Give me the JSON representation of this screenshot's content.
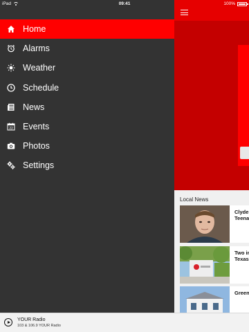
{
  "status_bar": {
    "device": "iPad",
    "time": "09:41",
    "battery": "100%",
    "battery_level": 1.0
  },
  "sidebar": {
    "items": [
      {
        "label": "Home",
        "icon": "home-icon",
        "active": true
      },
      {
        "label": "Alarms",
        "icon": "alarm-clock-icon",
        "active": false
      },
      {
        "label": "Weather",
        "icon": "sun-icon",
        "active": false
      },
      {
        "label": "Schedule",
        "icon": "clock-icon",
        "active": false
      },
      {
        "label": "News",
        "icon": "newspaper-icon",
        "active": false
      },
      {
        "label": "Events",
        "icon": "calendar-icon",
        "active": false
      },
      {
        "label": "Photos",
        "icon": "camera-icon",
        "active": false
      },
      {
        "label": "Settings",
        "icon": "gears-icon",
        "active": false
      }
    ]
  },
  "player": {
    "station": "YOUR Radio",
    "subtitle": "103 & 106.9 YOUR Radio"
  },
  "main": {
    "section_title": "Local News",
    "news": [
      {
        "line1": "Clyde",
        "line2": "Teena"
      },
      {
        "line1": "Two in",
        "line2": "Texas"
      },
      {
        "line1": "Green",
        "line2": ""
      }
    ]
  },
  "colors": {
    "accent": "#ff0000",
    "sidebar_bg": "#333333",
    "topbar": "#e60000",
    "hero": "#c40000"
  }
}
